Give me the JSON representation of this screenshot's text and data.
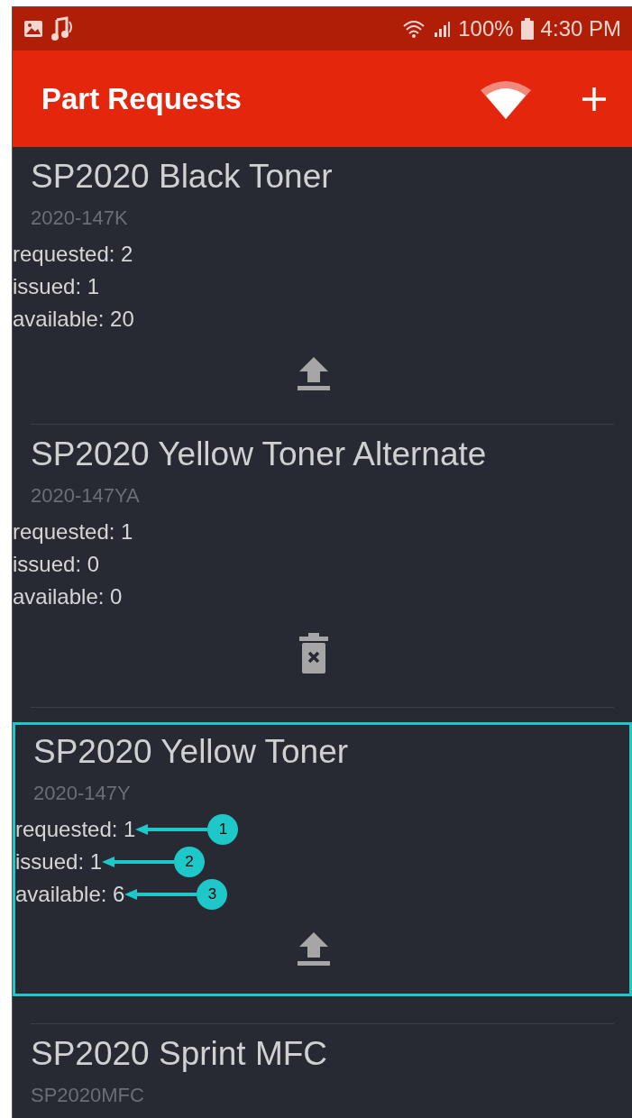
{
  "status_bar": {
    "battery": "100%",
    "time": "4:30 PM"
  },
  "app_bar": {
    "title": "Part Requests"
  },
  "items": [
    {
      "name": "SP2020 Black Toner",
      "part_no": "2020-147K",
      "highlighted": false,
      "kind": "upload",
      "stats": [
        {
          "text": "requested: 2"
        },
        {
          "text": "issued: 1"
        },
        {
          "text": "available: 20"
        }
      ]
    },
    {
      "name": "SP2020 Yellow Toner Alternate",
      "part_no": "2020-147YA",
      "highlighted": false,
      "kind": "delete",
      "stats": [
        {
          "text": "requested: 1"
        },
        {
          "text": "issued: 0"
        },
        {
          "text": "available: 0"
        }
      ]
    },
    {
      "name": "SP2020 Yellow Toner",
      "part_no": "2020-147Y",
      "highlighted": true,
      "kind": "upload",
      "stats": [
        {
          "text": "requested: 1",
          "callout": "1"
        },
        {
          "text": "issued: 1",
          "callout": "2"
        },
        {
          "text": "available: 6",
          "callout": "3"
        }
      ]
    },
    {
      "name": "SP2020 Sprint MFC",
      "part_no": "SP2020MFC",
      "highlighted": false
    }
  ]
}
